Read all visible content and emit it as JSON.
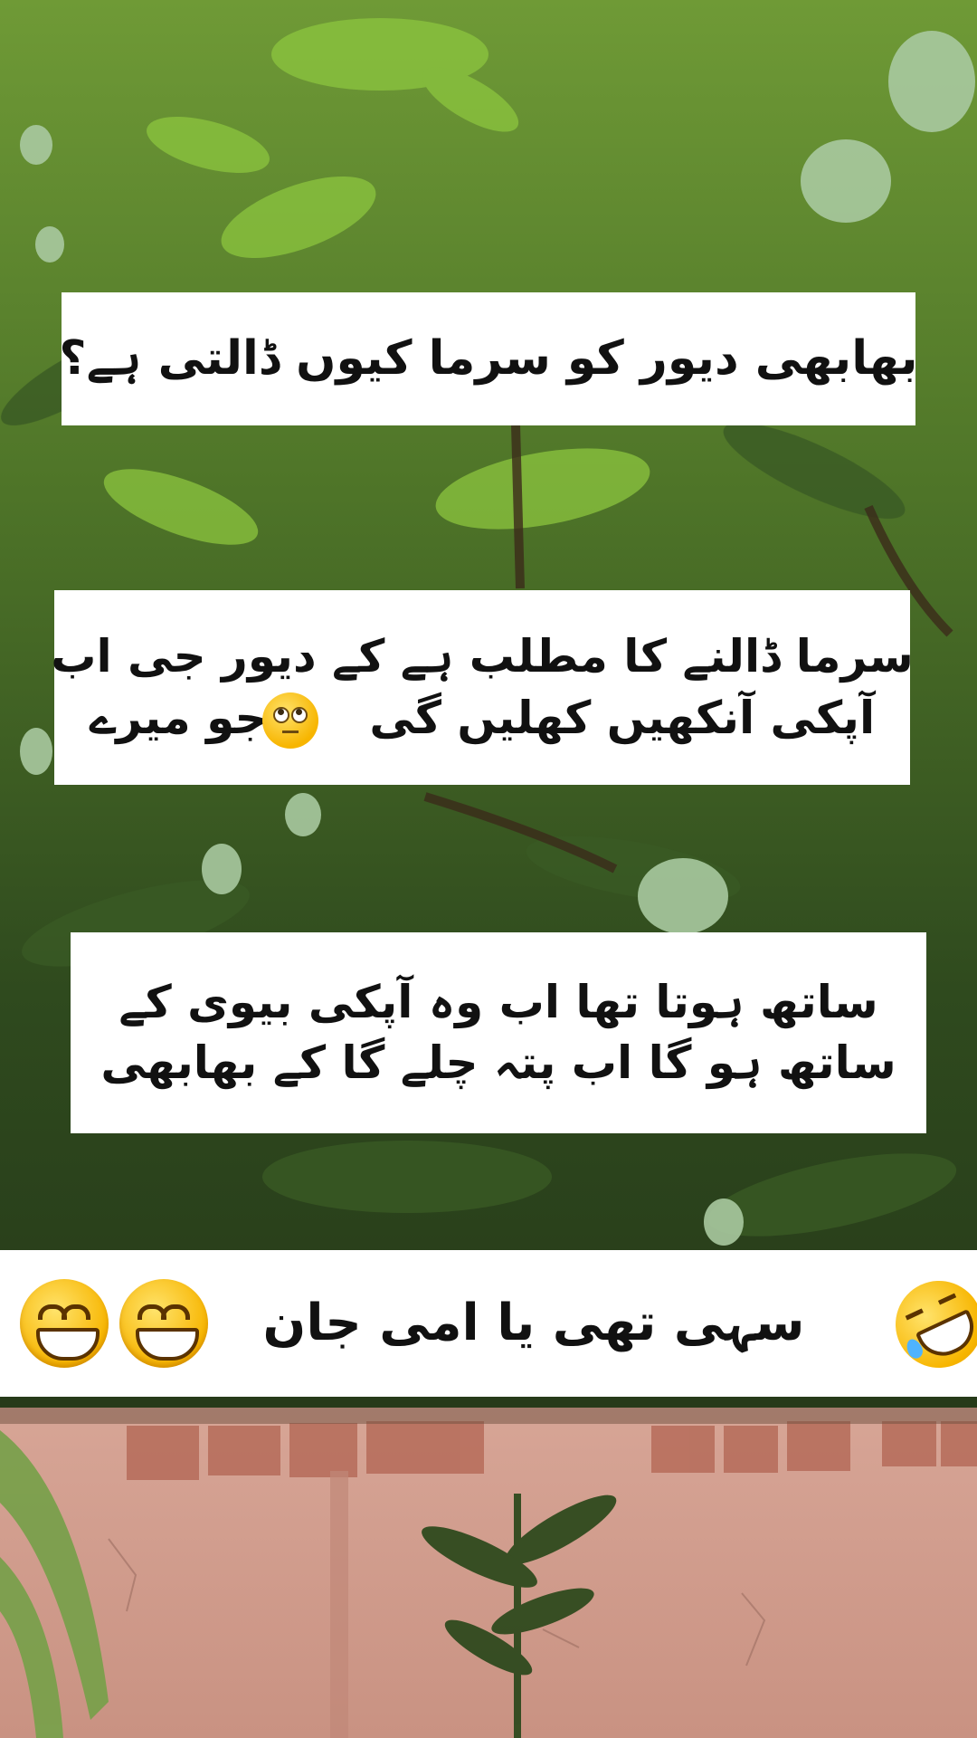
{
  "captions": {
    "q1": "بھابھی دیور کو سرما کیوں ڈالتی ہے؟",
    "a1_line1": "سرما ڈالنے کا مطلب ہے کے دیور جی اب",
    "a1_line2_start": "آپکی آنکھیں کھلیں گی",
    "a1_line2_end": "جو میرے",
    "a2_line1": "ساتھ ہوتا تھا اب وہ آپکی بیوی کے",
    "a2_line2": "ساتھ ہو گا اب پتہ چلے گا کے بھابھی",
    "final": "سہی تھی یا امی جان"
  },
  "icons": {
    "eye_roll": "face-with-rolling-eyes-icon",
    "grin": "grinning-face-icon",
    "rofl": "rolling-on-floor-laughing-icon"
  },
  "colors": {
    "caption_bg": "#ffffff",
    "caption_text": "#111111",
    "foliage_dark": "#2f4a1e",
    "foliage_light": "#8cc63f",
    "wall": "#d9a99a",
    "brick": "#b86f5d"
  }
}
